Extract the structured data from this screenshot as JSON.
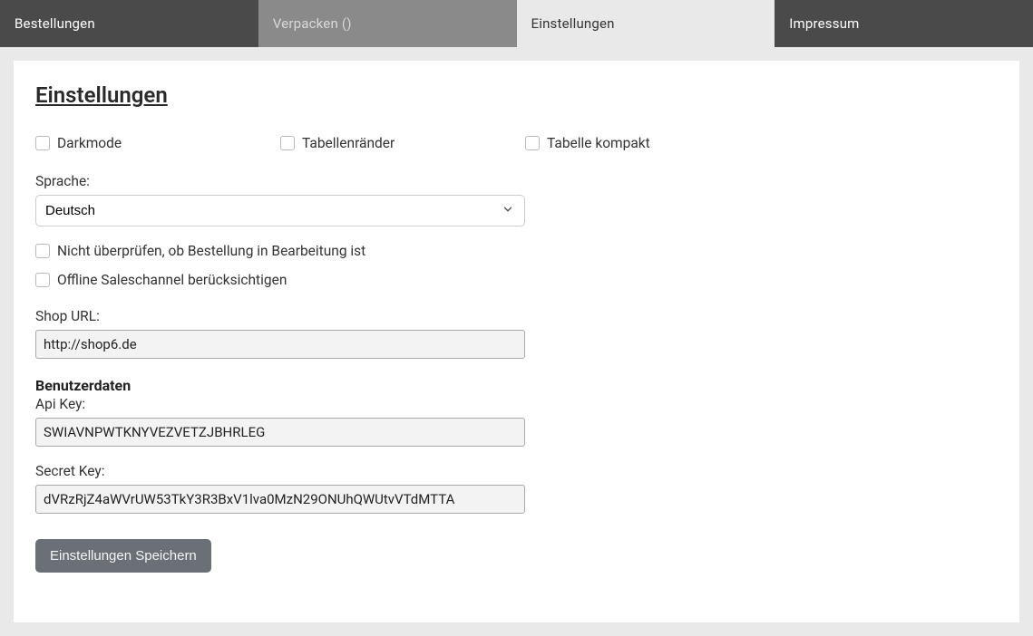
{
  "tabs": {
    "orders": "Bestellungen",
    "pack": "Verpacken ()",
    "settings": "Einstellungen",
    "imprint": "Impressum"
  },
  "page_title": "Einstellungen",
  "checks": {
    "darkmode": "Darkmode",
    "table_borders": "Tabellenränder",
    "table_compact": "Tabelle kompakt",
    "no_check_processing": "Nicht überprüfen, ob Bestellung in Bearbeitung ist",
    "offline_sales": "Offline Saleschannel berücksichtigen"
  },
  "language": {
    "label": "Sprache:",
    "selected": "Deutsch"
  },
  "shop_url": {
    "label": "Shop URL:",
    "value": "http://shop6.de"
  },
  "user_section_head": "Benutzerdaten",
  "api_key": {
    "label": "Api Key:",
    "value": "SWIAVNPWTKNYVEZVETZJBHRLEG"
  },
  "secret_key": {
    "label": "Secret Key:",
    "value": "dVRzRjZ4aWVrUW53TkY3R3BxV1lva0MzN29ONUhQWUtvVTdMTTA"
  },
  "save_label": "Einstellungen Speichern"
}
